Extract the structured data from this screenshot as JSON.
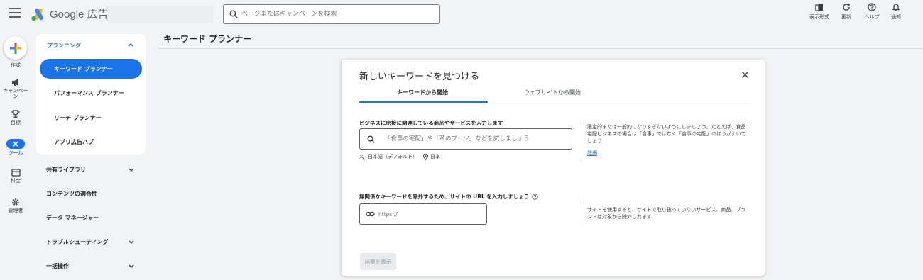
{
  "app": {
    "logo_text": "Google 広告"
  },
  "search": {
    "placeholder": "ページまたはキャンペーンを検索"
  },
  "toolbar": {
    "view_label": "表示形式",
    "refresh_label": "更新",
    "help_label": "ヘルプ",
    "notifications_label": "通知"
  },
  "rail": {
    "create": "作成",
    "campaigns": "キャンペーン",
    "goals": "目標",
    "tools": "ツール",
    "billing": "料金",
    "admin": "管理者"
  },
  "nav": {
    "section": "プランニング",
    "items": [
      {
        "label": "キーワード プランナー"
      },
      {
        "label": "パフォーマンス プランナー"
      },
      {
        "label": "リーチ プランナー"
      },
      {
        "label": "アプリ広告ハブ"
      }
    ],
    "other_sections": [
      {
        "label": "共有ライブラリ"
      },
      {
        "label": "コンテンツの適合性"
      },
      {
        "label": "データ マネージャー"
      },
      {
        "label": "トラブルシューティング"
      },
      {
        "label": "一括操作"
      }
    ]
  },
  "page": {
    "title": "キーワード プランナー"
  },
  "dialog": {
    "title": "新しいキーワードを見つける",
    "tabs": [
      {
        "label": "キーワードから開始"
      },
      {
        "label": "ウェブサイトから開始"
      }
    ],
    "keyword_label": "ビジネスに密接に関連している商品やサービスを入力します",
    "keyword_placeholder": "「食事の宅配」や「革のブーツ」などを試しましょう",
    "language": "日本語（デフォルト）",
    "location": "日本",
    "keyword_hint": "限定的または一般的になりすぎないようにしましょう。たとえば、食品宅配ビジネスの場合は「食事」ではなく「食事の宅配」のほうがよいでしょう",
    "details_link": "詳細",
    "url_label": "無関係なキーワードを除外するため、サイトの URL を入力しましょう",
    "url_placeholder": "https://",
    "url_hint": "サイトを使用すると、サイトで取り扱っていないサービス、商品、ブランドは対象から除外されます",
    "submit_label": "結果を表示"
  },
  "colors": {
    "accent": "#1a73e8",
    "background": "#f1f3f4"
  }
}
